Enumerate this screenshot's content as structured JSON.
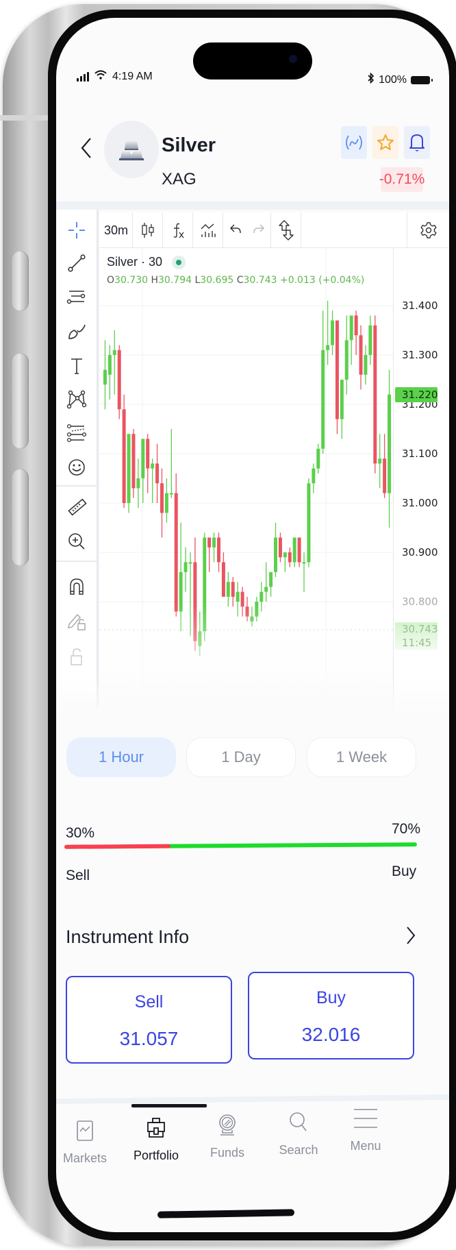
{
  "status_bar": {
    "time": "4:19 AM",
    "battery": "100%"
  },
  "header": {
    "asset_name": "Silver",
    "asset_code": "XAG",
    "change_percent": "-0.71%",
    "actions": [
      "chart-signal-icon",
      "star-icon",
      "bell-icon"
    ]
  },
  "chart_toolbar": {
    "interval": "30m",
    "items": [
      "candles-icon",
      "indicators-icon",
      "compare-icon",
      "undo-icon",
      "redo-icon",
      "swap-icon"
    ],
    "settings": "gear-icon"
  },
  "drawing_tools": [
    "crosshair",
    "trend-line",
    "parallel-channel",
    "brush",
    "text",
    "pattern",
    "fib-retracement",
    "emoji",
    "ruler",
    "zoom-in",
    "magnet",
    "lock-drawings",
    "lock"
  ],
  "chart_data": {
    "type": "candlestick",
    "title": "Silver · 30",
    "ohlc_legend": {
      "O": "30.730",
      "H": "30.794",
      "L": "30.695",
      "C": "30.743",
      "change": "+0.013 (+0.04%)"
    },
    "y_ticks": [
      "31.400",
      "31.300",
      "31.200",
      "31.100",
      "31.000",
      "30.900",
      "30.800"
    ],
    "ylim": [
      30.72,
      31.45
    ],
    "last_price": "31.220",
    "crosshair_price": "30.743",
    "crosshair_time": "11:45",
    "colors": {
      "up": "#5ccf4c",
      "down": "#ea5461"
    },
    "candles": [
      {
        "o": 31.24,
        "h": 31.33,
        "l": 31.19,
        "c": 31.27
      },
      {
        "o": 31.26,
        "h": 31.32,
        "l": 31.21,
        "c": 31.3
      },
      {
        "o": 31.3,
        "h": 31.35,
        "l": 31.22,
        "c": 31.31
      },
      {
        "o": 31.31,
        "h": 31.32,
        "l": 31.17,
        "c": 31.19
      },
      {
        "o": 31.19,
        "h": 31.22,
        "l": 30.99,
        "c": 31.0
      },
      {
        "o": 31.0,
        "h": 31.06,
        "l": 30.98,
        "c": 31.14
      },
      {
        "o": 31.14,
        "h": 31.15,
        "l": 31.01,
        "c": 31.03
      },
      {
        "o": 31.03,
        "h": 31.09,
        "l": 30.99,
        "c": 31.05
      },
      {
        "o": 31.05,
        "h": 31.12,
        "l": 31.0,
        "c": 31.13
      },
      {
        "o": 31.13,
        "h": 31.14,
        "l": 31.02,
        "c": 31.07
      },
      {
        "o": 31.07,
        "h": 31.09,
        "l": 31.0,
        "c": 31.08
      },
      {
        "o": 31.08,
        "h": 31.12,
        "l": 31.0,
        "c": 31.04
      },
      {
        "o": 31.04,
        "h": 31.07,
        "l": 30.93,
        "c": 30.98
      },
      {
        "o": 30.98,
        "h": 31.05,
        "l": 30.96,
        "c": 31.02
      },
      {
        "o": 31.02,
        "h": 31.15,
        "l": 31.01,
        "c": 31.02
      },
      {
        "o": 31.02,
        "h": 31.06,
        "l": 30.77,
        "c": 30.78
      },
      {
        "o": 30.78,
        "h": 30.96,
        "l": 30.74,
        "c": 30.86
      },
      {
        "o": 30.86,
        "h": 30.91,
        "l": 30.82,
        "c": 30.88
      },
      {
        "o": 30.88,
        "h": 30.9,
        "l": 30.73,
        "c": 30.88
      },
      {
        "o": 30.88,
        "h": 30.93,
        "l": 30.7,
        "c": 30.72
      },
      {
        "o": 30.71,
        "h": 30.78,
        "l": 30.69,
        "c": 30.74
      },
      {
        "o": 30.74,
        "h": 30.94,
        "l": 30.72,
        "c": 30.93
      },
      {
        "o": 30.93,
        "h": 30.93,
        "l": 30.86,
        "c": 30.91
      },
      {
        "o": 30.91,
        "h": 30.94,
        "l": 30.88,
        "c": 30.93
      },
      {
        "o": 30.93,
        "h": 30.94,
        "l": 30.86,
        "c": 30.88
      },
      {
        "o": 30.88,
        "h": 30.9,
        "l": 30.81,
        "c": 30.81
      },
      {
        "o": 30.81,
        "h": 30.86,
        "l": 30.79,
        "c": 30.84
      },
      {
        "o": 30.84,
        "h": 30.85,
        "l": 30.79,
        "c": 30.81
      },
      {
        "o": 30.8,
        "h": 30.84,
        "l": 30.77,
        "c": 30.82
      },
      {
        "o": 30.82,
        "h": 30.83,
        "l": 30.77,
        "c": 30.79
      },
      {
        "o": 30.79,
        "h": 30.81,
        "l": 30.76,
        "c": 30.77
      },
      {
        "o": 30.76,
        "h": 30.79,
        "l": 30.75,
        "c": 30.77
      },
      {
        "o": 30.77,
        "h": 30.81,
        "l": 30.76,
        "c": 30.8
      },
      {
        "o": 30.8,
        "h": 30.84,
        "l": 30.78,
        "c": 30.82
      },
      {
        "o": 30.82,
        "h": 30.88,
        "l": 30.8,
        "c": 30.83
      },
      {
        "o": 30.83,
        "h": 30.86,
        "l": 30.81,
        "c": 30.86
      },
      {
        "o": 30.86,
        "h": 30.96,
        "l": 30.85,
        "c": 30.93
      },
      {
        "o": 30.93,
        "h": 30.94,
        "l": 30.88,
        "c": 30.89
      },
      {
        "o": 30.89,
        "h": 30.9,
        "l": 30.86,
        "c": 30.9
      },
      {
        "o": 30.9,
        "h": 30.91,
        "l": 30.87,
        "c": 30.88
      },
      {
        "o": 30.88,
        "h": 30.93,
        "l": 30.87,
        "c": 30.93
      },
      {
        "o": 30.93,
        "h": 30.93,
        "l": 30.87,
        "c": 30.88
      },
      {
        "o": 30.88,
        "h": 30.9,
        "l": 30.82,
        "c": 30.88
      },
      {
        "o": 30.88,
        "h": 31.05,
        "l": 30.87,
        "c": 31.04
      },
      {
        "o": 31.04,
        "h": 31.08,
        "l": 31.02,
        "c": 31.07
      },
      {
        "o": 31.07,
        "h": 31.12,
        "l": 31.06,
        "c": 31.11
      },
      {
        "o": 31.11,
        "h": 31.39,
        "l": 31.1,
        "c": 31.31
      },
      {
        "o": 31.31,
        "h": 31.41,
        "l": 31.28,
        "c": 31.32
      },
      {
        "o": 31.32,
        "h": 31.39,
        "l": 31.3,
        "c": 31.37
      },
      {
        "o": 31.37,
        "h": 31.37,
        "l": 31.14,
        "c": 31.17
      },
      {
        "o": 31.17,
        "h": 31.24,
        "l": 31.13,
        "c": 31.25
      },
      {
        "o": 31.25,
        "h": 31.38,
        "l": 31.22,
        "c": 31.33
      },
      {
        "o": 31.33,
        "h": 31.37,
        "l": 31.28,
        "c": 31.38
      },
      {
        "o": 31.38,
        "h": 31.39,
        "l": 31.3,
        "c": 31.34
      },
      {
        "o": 31.34,
        "h": 31.36,
        "l": 31.23,
        "c": 31.26
      },
      {
        "o": 31.26,
        "h": 31.32,
        "l": 31.24,
        "c": 31.3
      },
      {
        "o": 31.3,
        "h": 31.38,
        "l": 31.28,
        "c": 31.36
      },
      {
        "o": 31.36,
        "h": 31.38,
        "l": 31.06,
        "c": 31.08
      },
      {
        "o": 31.08,
        "h": 31.14,
        "l": 31.03,
        "c": 31.09
      },
      {
        "o": 31.09,
        "h": 31.14,
        "l": 31.01,
        "c": 31.02
      },
      {
        "o": 31.02,
        "h": 31.27,
        "l": 30.95,
        "c": 31.22
      }
    ]
  },
  "timeframes": [
    {
      "label": "1 Hour",
      "active": true
    },
    {
      "label": "1 Day",
      "active": false
    },
    {
      "label": "1 Week",
      "active": false
    }
  ],
  "sentiment": {
    "sell_percent": 30,
    "buy_percent": 70,
    "sell_text": "30%",
    "buy_text": "70%",
    "sell_label": "Sell",
    "buy_label": "Buy",
    "sell_color": "#ff3d53",
    "buy_color": "#1edb2c"
  },
  "instrument_info": {
    "label": "Instrument Info"
  },
  "trade": {
    "sell": {
      "label": "Sell",
      "price": "31.057"
    },
    "buy": {
      "label": "Buy",
      "price": "32.016"
    },
    "accent": "#3b44e0"
  },
  "bottom_nav": [
    {
      "label": "Markets",
      "icon": "markets-icon",
      "active": false
    },
    {
      "label": "Portfolio",
      "icon": "portfolio-icon",
      "active": true
    },
    {
      "label": "Funds",
      "icon": "funds-icon",
      "active": false
    },
    {
      "label": "Search",
      "icon": "search-icon",
      "active": false
    },
    {
      "label": "Menu",
      "icon": "menu-icon",
      "active": false
    }
  ]
}
